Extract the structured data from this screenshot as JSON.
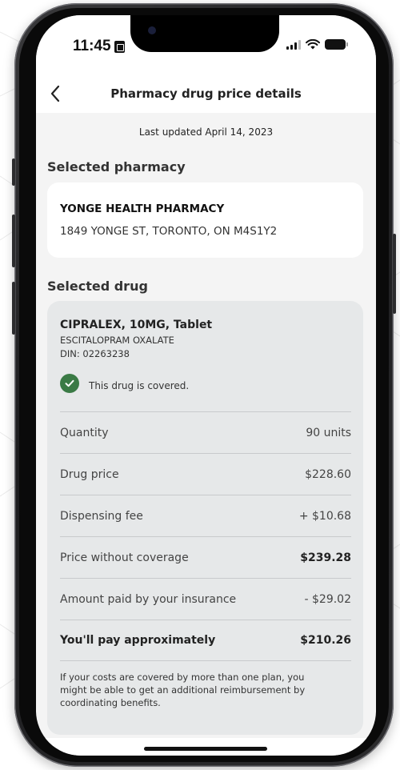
{
  "status_bar": {
    "time": "11:45"
  },
  "header": {
    "title": "Pharmacy drug price details"
  },
  "last_updated": "Last updated April 14, 2023",
  "pharmacy_section": {
    "title": "Selected pharmacy",
    "name": "YONGE HEALTH PHARMACY",
    "address": "1849 YONGE ST, TORONTO, ON M4S1Y2"
  },
  "drug_section": {
    "title": "Selected drug",
    "name": "CIPRALEX, 10MG, Tablet",
    "generic": "ESCITALOPRAM OXALATE",
    "din": "DIN: 02263238",
    "coverage_status": "This drug is covered."
  },
  "price_rows": [
    {
      "label": "Quantity",
      "value": "90 units"
    },
    {
      "label": "Drug price",
      "value": "$228.60"
    },
    {
      "label": "Dispensing fee",
      "value": "+ $10.68"
    },
    {
      "label": "Price without coverage",
      "value": "$239.28"
    },
    {
      "label": "Amount paid by your insurance",
      "value": "- $29.02"
    },
    {
      "label": "You'll pay approximately",
      "value": "$210.26"
    }
  ],
  "disclaimer": "If your costs are covered by more than one plan, you might be able to get an additional reimbursement by coordinating benefits.",
  "colors": {
    "accent_check": "#3a7a45",
    "card_bg": "#e6e8e9",
    "screen_bg": "#f4f4f4"
  }
}
